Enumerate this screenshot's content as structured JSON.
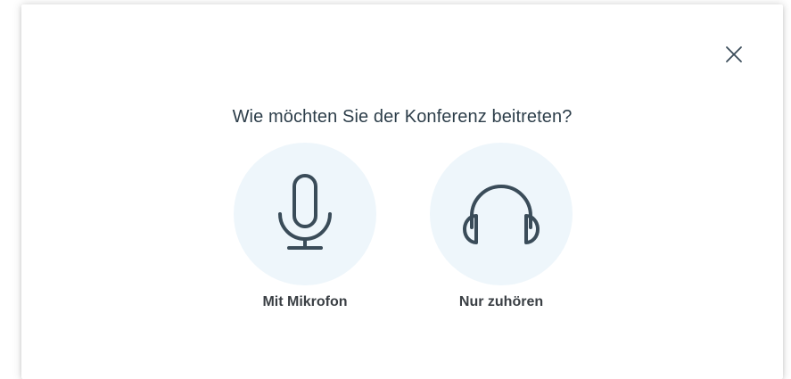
{
  "dialog": {
    "title": "Wie möchten Sie der Konferenz beitreten?",
    "close_icon": "close-icon",
    "options": [
      {
        "label": "Mit Mikrofon",
        "icon": "microphone-icon"
      },
      {
        "label": "Nur zuhören",
        "icon": "headphones-icon"
      }
    ]
  },
  "colors": {
    "icon_stroke": "#3a4c59",
    "circle_bg": "#eef6fb",
    "title_text": "#2d3e4a",
    "label_text": "#3a3f44"
  }
}
